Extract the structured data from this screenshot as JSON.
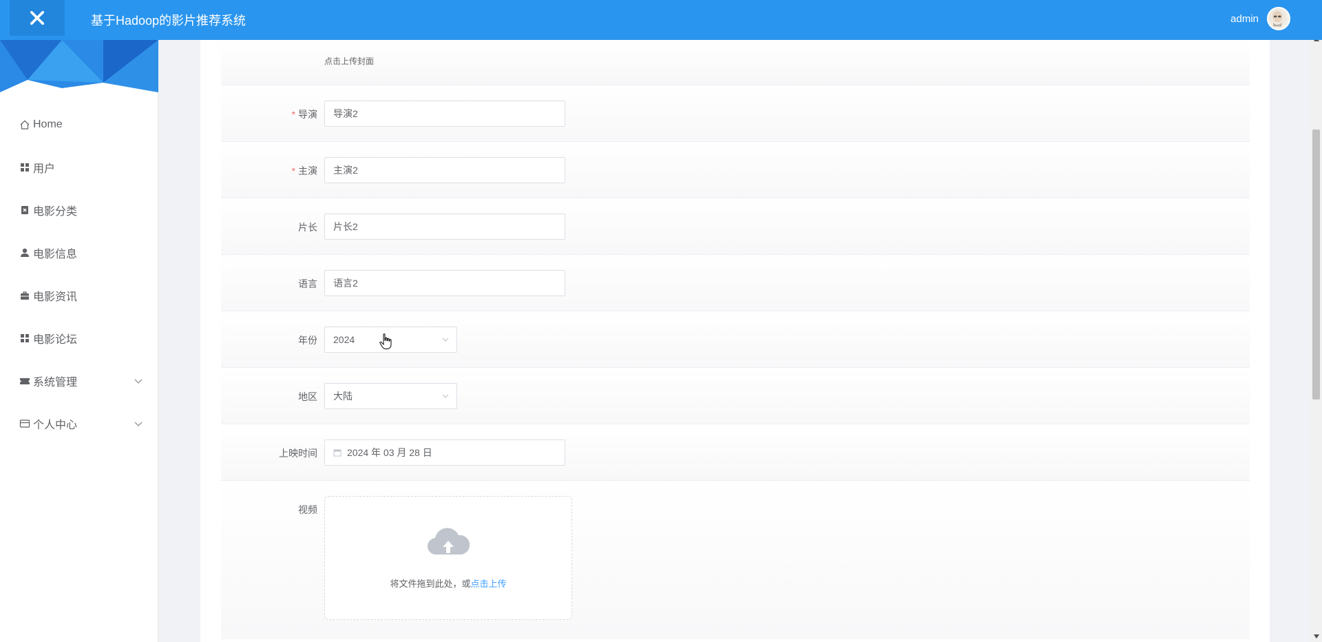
{
  "header": {
    "title": "基于Hadoop的影片推荐系统",
    "user": "admin"
  },
  "sidebar": {
    "items": [
      {
        "label": "Home",
        "icon": "home-icon"
      },
      {
        "label": "用户",
        "icon": "grid-icon"
      },
      {
        "label": "电影分类",
        "icon": "clipboard-icon"
      },
      {
        "label": "电影信息",
        "icon": "user-icon"
      },
      {
        "label": "电影资讯",
        "icon": "briefcase-icon"
      },
      {
        "label": "电影论坛",
        "icon": "grid-icon"
      },
      {
        "label": "系统管理",
        "icon": "ticket-icon",
        "expandable": true
      },
      {
        "label": "个人中心",
        "icon": "card-icon",
        "expandable": true
      }
    ]
  },
  "form": {
    "cover_hint": "点击上传封面",
    "director": {
      "label": "导演",
      "value": "导演2",
      "required": true
    },
    "actors": {
      "label": "主演",
      "value": "主演2",
      "required": true
    },
    "duration": {
      "label": "片长",
      "value": "片长2"
    },
    "language": {
      "label": "语言",
      "value": "语言2"
    },
    "year": {
      "label": "年份",
      "value": "2024"
    },
    "region": {
      "label": "地区",
      "value": "大陆"
    },
    "release": {
      "label": "上映时间",
      "value": "2024 年 03 月 28 日"
    },
    "video": {
      "label": "视频",
      "drop_text": "将文件拖到此处，或",
      "drop_link": "点击上传"
    }
  },
  "colors": {
    "header_bg": "#2a95ee",
    "required": "#f56c6c",
    "link": "#409eff"
  }
}
